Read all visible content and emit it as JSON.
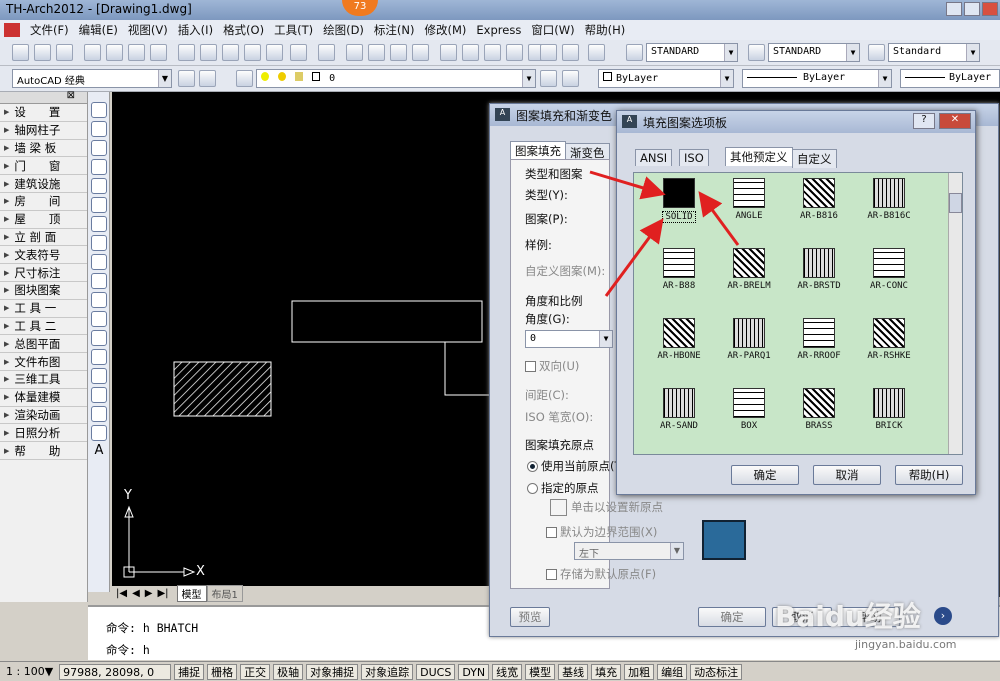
{
  "window": {
    "title": "TH-Arch2012 - [Drawing1.dwg]",
    "badge": "73"
  },
  "menu": [
    "文件(F)",
    "编辑(E)",
    "视图(V)",
    "插入(I)",
    "格式(O)",
    "工具(T)",
    "绘图(D)",
    "标注(N)",
    "修改(M)",
    "Express",
    "窗口(W)",
    "帮助(H)"
  ],
  "toolbar": {
    "textstyle": "STANDARD",
    "dimstyle": "STANDARD",
    "tablestyle": "Standard",
    "workspace": "AutoCAD 经典",
    "layer": "0",
    "color": "ByLayer",
    "linetype": "ByLayer",
    "lineweight": "ByLayer"
  },
  "leftpanel": [
    "设　　置",
    "轴网柱子",
    "墙 梁 板",
    "门　　窗",
    "建筑设施",
    "房　　间",
    "屋　　顶",
    "立 剖 面",
    "文表符号",
    "尺寸标注",
    "图块图案",
    "工 具 一",
    "工 具 二",
    "总图平面",
    "文件布图",
    "三维工具",
    "体量建模",
    "渲染动画",
    "日照分析",
    "帮　　助"
  ],
  "canvas": {
    "axis_x": "X",
    "axis_y": "Y"
  },
  "layout_tabs": {
    "model": "模型",
    "layout1": "布局1"
  },
  "command": {
    "line1": "命令: h BHATCH",
    "line2": "命令: h"
  },
  "status": {
    "scale": "1 : 100▼",
    "coords": "97988, 28098, 0",
    "buttons": [
      "捕捉",
      "栅格",
      "正交",
      "极轴",
      "对象捕捉",
      "对象追踪",
      "DUCS",
      "DYN",
      "线宽",
      "模型",
      "基线",
      "填充",
      "加粗",
      "编组",
      "动态标注"
    ]
  },
  "hatch_dialog": {
    "title": "图案填充和渐变色",
    "tabs": [
      "图案填充",
      "渐变色"
    ],
    "type_group": "类型和图案",
    "type_label": "类型(Y):",
    "pattern_label": "图案(P):",
    "sample_label": "样例:",
    "custom_label": "自定义图案(M):",
    "angle_group": "角度和比例",
    "angle_label": "角度(G):",
    "angle_value": "0",
    "double_label": "双向(U)",
    "spacing_label": "间距(C):",
    "iso_label": "ISO 笔宽(O):",
    "origin_group": "图案填充原点",
    "use_current": "使用当前原点(T)",
    "specified": "指定的原点",
    "click_set": "单击以设置新原点",
    "default_ext": "默认为边界范围(X)",
    "position": "左下",
    "store_default": "存储为默认原点(F)",
    "preview_btn": "预览",
    "ok_btn": "确定",
    "cancel_btn": "取消",
    "help_btn": "帮助"
  },
  "palette_dialog": {
    "title": "填充图案选项板",
    "tabs": [
      "ANSI",
      "ISO",
      "其他预定义",
      "自定义"
    ],
    "patterns": [
      "SOLID",
      "ANGLE",
      "AR-B816",
      "AR-B816C",
      "AR-B88",
      "AR-BRELM",
      "AR-BRSTD",
      "AR-CONC",
      "AR-HBONE",
      "AR-PARQ1",
      "AR-RROOF",
      "AR-RSHKE",
      "AR-SAND",
      "BOX",
      "BRASS",
      "BRICK"
    ],
    "ok": "确定",
    "cancel": "取消",
    "help": "帮助(H)"
  },
  "watermark": {
    "brand": "Baidu经验",
    "url": "jingyan.baidu.com"
  }
}
